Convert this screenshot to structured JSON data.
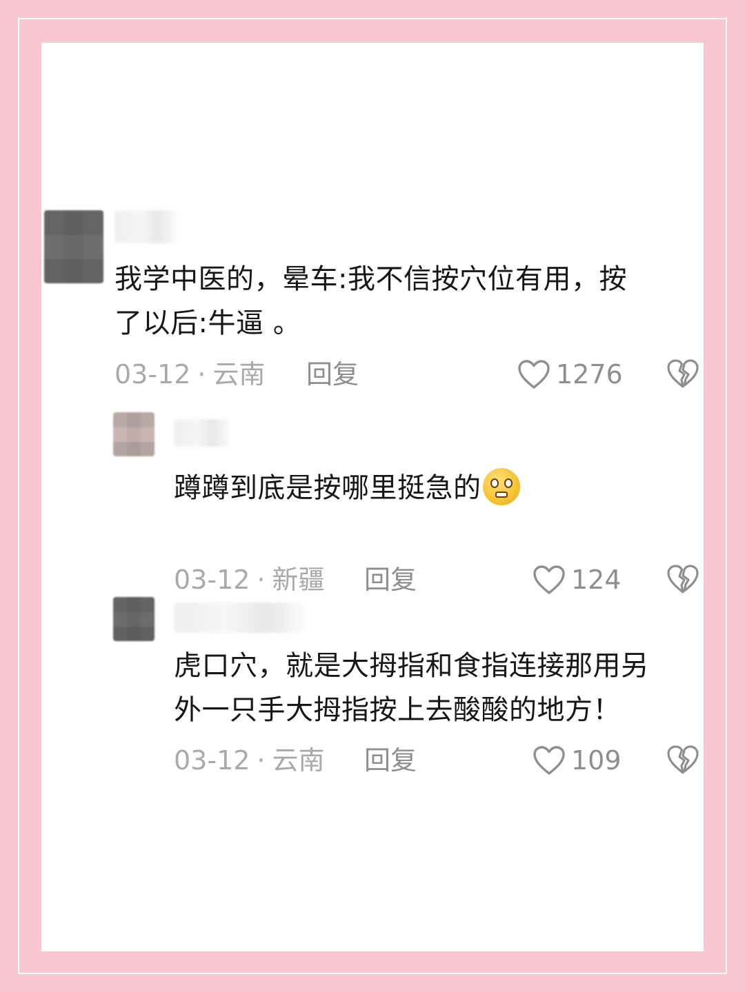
{
  "comments": [
    {
      "text": "我学中医的，晕车:我不信按穴位有用，按\n了以后:牛逼 。",
      "date": "03-12",
      "location": "云南",
      "reply_label": "回复",
      "likes": "1276"
    },
    {
      "text": "蹲蹲到底是按哪里挺急的",
      "emoji": "pleading-face-emoji",
      "date": "03-12",
      "location": "新疆",
      "reply_label": "回复",
      "likes": "124"
    },
    {
      "text": "虎口穴，就是大拇指和食指连接那用另\n外一只手大拇指按上去酸酸的地方！",
      "date": "03-12",
      "location": "云南",
      "reply_label": "回复",
      "likes": "109"
    }
  ],
  "meta_separator": "·",
  "icons": {
    "like": "heart-outline-icon",
    "dislike": "broken-heart-icon"
  },
  "colors": {
    "frame": "#f8c6d3",
    "text": "#161616",
    "meta": "#a9a9a9"
  }
}
